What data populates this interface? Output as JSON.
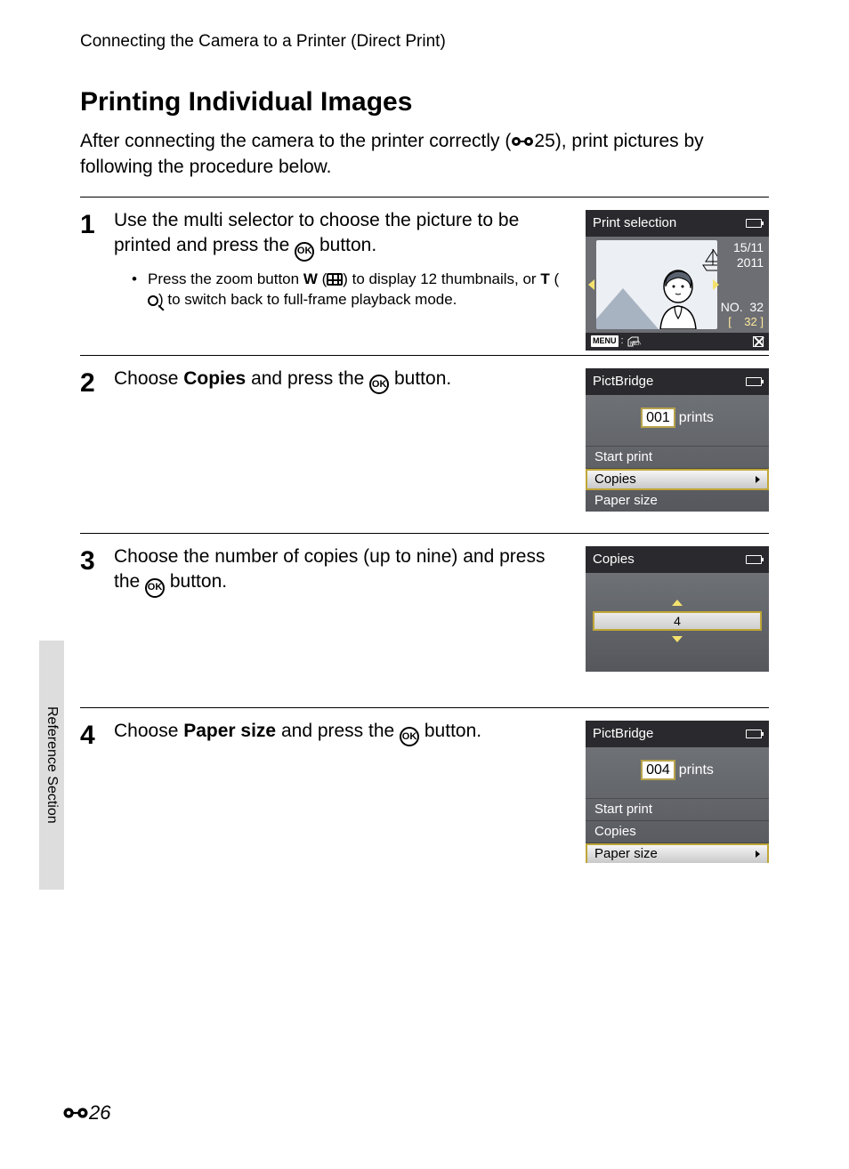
{
  "header": "Connecting the Camera to a Printer (Direct Print)",
  "title": "Printing Individual Images",
  "intro_pre": "After connecting the camera to the printer correctly (",
  "intro_ref": "25",
  "intro_post": "), print pictures by following the procedure below.",
  "steps": {
    "s1": {
      "num": "1",
      "main_pre": "Use the multi selector to choose the picture to be printed and press the ",
      "main_post": " button.",
      "bullet_a": "Press the zoom button ",
      "w": "W",
      "bullet_b": " (",
      "bullet_c": ") to display 12 thumbnails, or ",
      "t": "T",
      "bullet_d": " (",
      "bullet_e": ") to switch back to full-frame playback mode."
    },
    "s2": {
      "num": "2",
      "pre": "Choose ",
      "bold": "Copies",
      "post": " and press the ",
      "end": " button."
    },
    "s3": {
      "num": "3",
      "pre": "Choose the number of copies (up to nine) and press the ",
      "end": " button."
    },
    "s4": {
      "num": "4",
      "pre": "Choose ",
      "bold": "Paper size",
      "post": " and press the ",
      "end": " button."
    }
  },
  "lcd1": {
    "title": "Print selection",
    "date1": "15/11",
    "date2": "2011",
    "no": "NO.  32",
    "cnt": "[    32 ]",
    "menu": "MENU",
    "menu_hint": ":"
  },
  "lcd2": {
    "title": "PictBridge",
    "prints_num": "001",
    "prints_lbl": "prints",
    "items": [
      "Start print",
      "Copies",
      "Paper size"
    ]
  },
  "lcd3": {
    "title": "Copies",
    "value": "4"
  },
  "lcd4": {
    "title": "PictBridge",
    "prints_num": "004",
    "prints_lbl": "prints",
    "items": [
      "Start print",
      "Copies",
      "Paper size"
    ]
  },
  "tab": "Reference Section",
  "page_num": "26",
  "ok_label": "OK"
}
